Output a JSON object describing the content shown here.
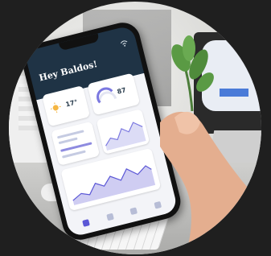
{
  "photo": {
    "accent_color": "#5b57d6",
    "screen_header_color": "#1f3345"
  },
  "phone_app": {
    "greeting": "Hey Baldos!",
    "weather_temp": "17°",
    "gauge_value": "87",
    "icons": [
      "wifi-icon",
      "sun-icon",
      "gauge-icon"
    ]
  }
}
